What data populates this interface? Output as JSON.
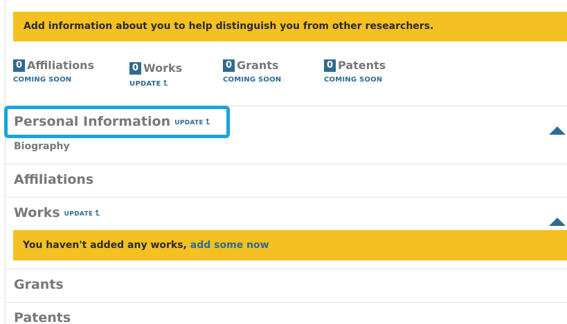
{
  "banner": {
    "text": "Add information about you to help distinguish you from other researchers."
  },
  "counts": [
    {
      "count": "0",
      "label": "Affiliations",
      "sub": "COMING SOON",
      "sub_icon": ""
    },
    {
      "count": "0",
      "label": "Works",
      "sub": "UPDATE",
      "sub_icon": "⮤"
    },
    {
      "count": "0",
      "label": "Grants",
      "sub": "COMING SOON",
      "sub_icon": ""
    },
    {
      "count": "0",
      "label": "Patents",
      "sub": "COMING SOON",
      "sub_icon": ""
    }
  ],
  "sections": {
    "personal": {
      "title": "Personal Information",
      "update": "UPDATE",
      "update_icon": "⮤",
      "subitem": "Biography"
    },
    "affiliations": {
      "title": "Affiliations"
    },
    "works": {
      "title": "Works",
      "update": "UPDATE",
      "update_icon": "⮤"
    },
    "grants": {
      "title": "Grants"
    },
    "patents": {
      "title": "Patents"
    }
  },
  "works_notice": {
    "text": "You haven't added any works,",
    "link": "add some now"
  },
  "icons": {
    "update": "upload-arrow-icon",
    "collapse": "caret-up-icon"
  },
  "colors": {
    "banner_bg": "#f4c022",
    "accent_blue": "#2e6b8f",
    "highlight": "#1aa3de",
    "section_text": "#787878"
  }
}
